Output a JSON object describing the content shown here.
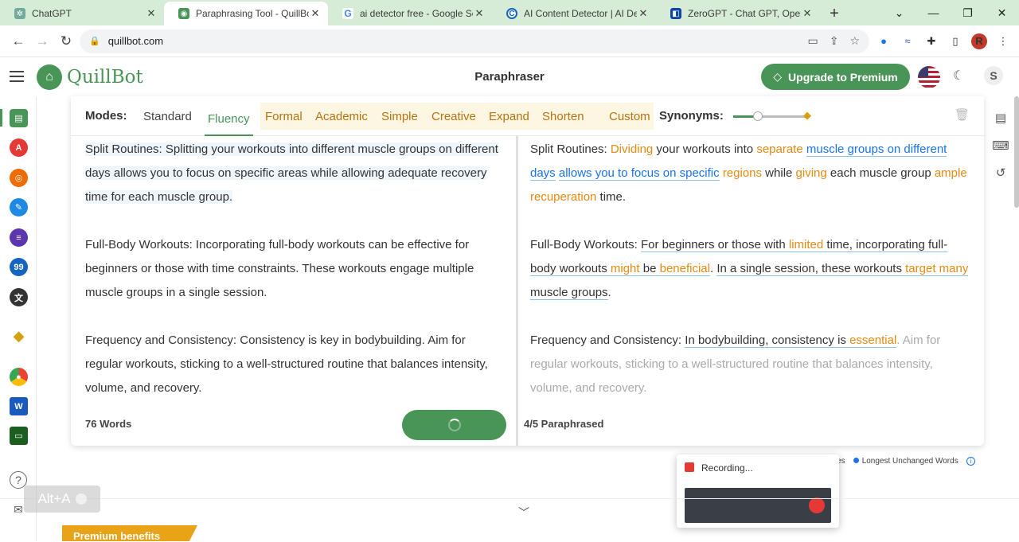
{
  "browser": {
    "tabs": [
      {
        "title": "ChatGPT",
        "favicon_color": "#74aa9c",
        "active": false
      },
      {
        "title": "Paraphrasing Tool - QuillBot",
        "favicon_color": "#499557",
        "active": true
      },
      {
        "title": "ai detector free - Google Sea",
        "favicon_color": "#4285f4",
        "active": false
      },
      {
        "title": "AI Content Detector | AI Dete",
        "favicon_color": "#1565c0",
        "active": false
      },
      {
        "title": "ZeroGPT - Chat GPT, Open A",
        "favicon_color": "#0d47a1",
        "active": false
      }
    ],
    "url": "quillbot.com",
    "profile_initial": "R"
  },
  "header": {
    "brand": "QuillBot",
    "title": "Paraphraser",
    "upgrade_label": "Upgrade to Premium",
    "user_initial": "S"
  },
  "modes": {
    "label": "Modes:",
    "items": [
      "Standard",
      "Fluency",
      "Formal",
      "Academic",
      "Simple",
      "Creative",
      "Expand",
      "Shorten",
      "Custom"
    ],
    "active": "Fluency",
    "synonyms_label": "Synonyms:"
  },
  "input": {
    "paragraphs": [
      "Split Routines: Splitting your workouts into different muscle groups on different days allows you to focus on specific areas while allowing adequate recovery time for each muscle group.",
      "Full-Body Workouts: Incorporating full-body workouts can be effective for beginners or those with time constraints. These workouts engage multiple muscle groups in a single session.",
      "Frequency and Consistency: Consistency is key in bodybuilding. Aim for regular workouts, sticking to a well-structured routine that balances intensity, volume, and recovery."
    ],
    "word_count": "76 Words"
  },
  "output": {
    "p1": {
      "a": "Split Routines: ",
      "b": "Dividing",
      "c": " your workouts into ",
      "d": "separate",
      "e": " ",
      "f": "muscle groups on different days",
      "g": " ",
      "h": "allows you to focus on specific",
      "i": " ",
      "j": "regions",
      "k": " while ",
      "l": "giving",
      "m": " each muscle group ",
      "n": "ample recuperation",
      "o": " time."
    },
    "p2": {
      "a": "Full-Body Workouts: ",
      "b": "For beginners or those with ",
      "c": "limited",
      "d": " time, incorporating full-body workouts ",
      "e": "might",
      "f": " be ",
      "g": "beneficial",
      "h": ". ",
      "i": "In a single session, these workouts ",
      "j": "target many",
      "k": " muscle groups",
      "l": "."
    },
    "p3": {
      "a": "Frequency and Consistency: ",
      "b": "In bodybuilding, consistency is ",
      "c": "essential",
      "d": ".",
      "e": " Aim for regular workouts, sticking to a well-structured routine that balances intensity, volume, and recovery."
    },
    "status": "4/5 Paraphrased"
  },
  "legend": {
    "changes": "nges",
    "longest_unchanged": "Longest Unchanged Words"
  },
  "recording": {
    "title": "Recording..."
  },
  "overlay": {
    "shortcut": "Alt+A",
    "premium_benefits": "Premium benefits"
  },
  "colors": {
    "brand_green": "#499557",
    "changed_word": "#e58a12",
    "structural_change": "#1a73e8",
    "premium_gold": "#e8a317"
  }
}
